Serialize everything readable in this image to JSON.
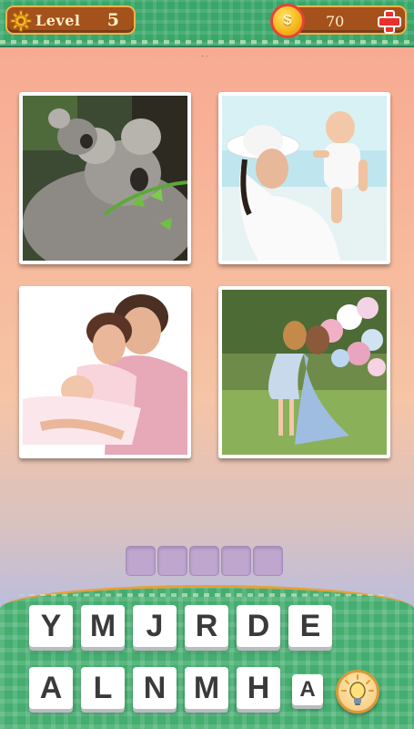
{
  "header": {
    "level_label": "Level",
    "level_number": "5",
    "coins": "70",
    "coin_symbol": "$"
  },
  "photos": [
    {
      "subject": "koala-mother-and-baby"
    },
    {
      "subject": "mother-lifting-baby-at-beach"
    },
    {
      "subject": "parents-with-baby"
    },
    {
      "subject": "mother-kissing-daughter-with-balloons"
    }
  ],
  "answer": {
    "slot_count": 5
  },
  "keyboard": {
    "row1": [
      "Y",
      "M",
      "J",
      "R",
      "D",
      "E"
    ],
    "row2": [
      "A",
      "L",
      "N",
      "M",
      "H",
      "A"
    ]
  },
  "colors": {
    "bar_green": "#3aa66a",
    "pill_brown": "#a4511c",
    "slot_purple": "#bfa6cf",
    "accent_red": "#e8302c"
  },
  "icons": {
    "settings": "gear-icon",
    "coin": "coin-icon",
    "add": "plus-icon",
    "hint": "lightbulb-icon"
  }
}
